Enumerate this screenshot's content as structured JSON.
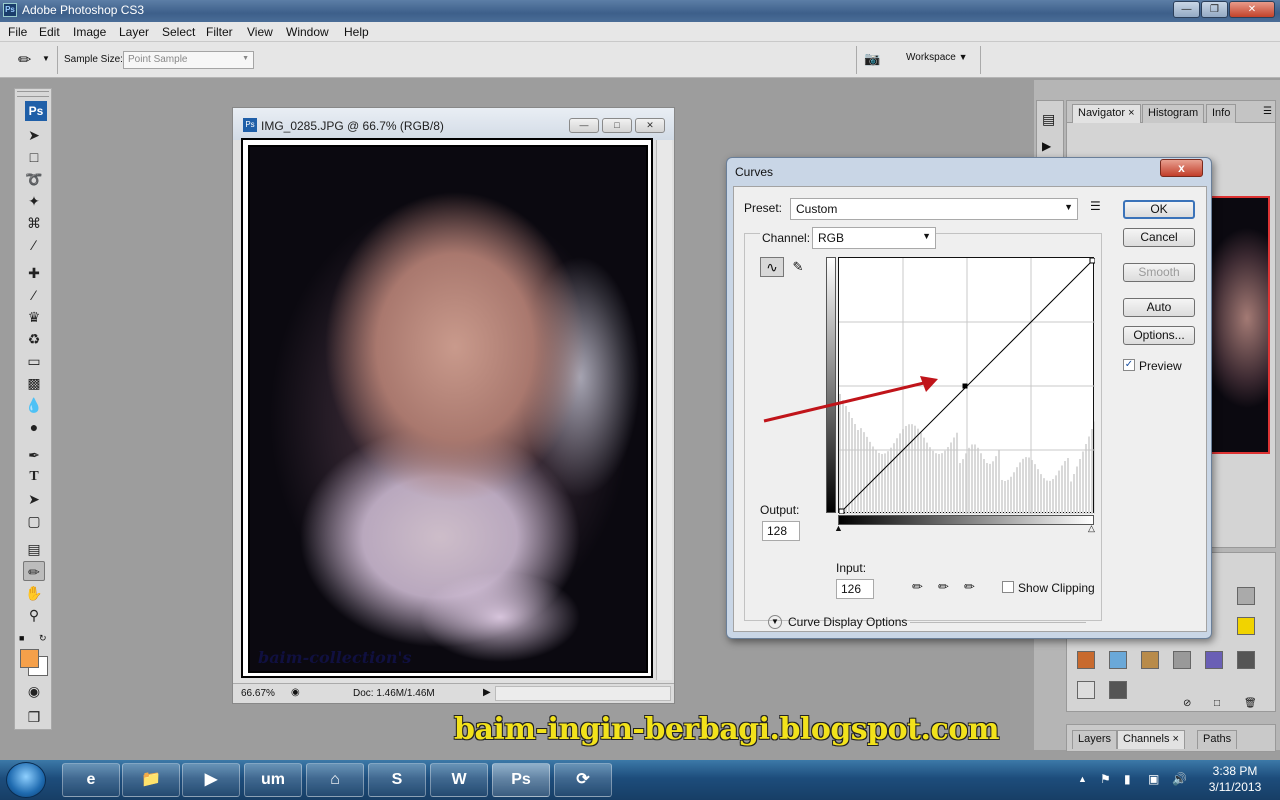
{
  "app": {
    "title": "Adobe Photoshop CS3",
    "logo": "Ps",
    "mini_logo": "Ps"
  },
  "menu": [
    "File",
    "Edit",
    "Image",
    "Layer",
    "Select",
    "Filter",
    "View",
    "Window",
    "Help"
  ],
  "options_bar": {
    "sample_size_label": "Sample Size:",
    "sample_size_value": "Point Sample",
    "workspace_label": "Workspace"
  },
  "document": {
    "title": "IMG_0285.JPG @ 66.7% (RGB/8)",
    "zoom": "66.67%",
    "doc_info": "Doc: 1.46M/1.46M",
    "photo_watermark": "baim-collection's"
  },
  "panels": {
    "navigator_tabs": [
      "Navigator",
      "Histogram",
      "Info"
    ],
    "layer_tabs": [
      "Layers",
      "Channels",
      "Paths"
    ]
  },
  "curves": {
    "title": "Curves",
    "close": "x",
    "preset_label": "Preset:",
    "preset_value": "Custom",
    "channel_label": "Channel:",
    "channel_value": "RGB",
    "output_label": "Output:",
    "output_value": "128",
    "input_label": "Input:",
    "input_value": "126",
    "show_clipping_label": "Show Clipping",
    "curve_display_label": "Curve Display Options",
    "buttons": {
      "ok": "OK",
      "cancel": "Cancel",
      "smooth": "Smooth",
      "auto": "Auto",
      "options": "Options..."
    },
    "preview_label": "Preview",
    "preview_checked": true,
    "point": {
      "input": 126,
      "output": 128
    }
  },
  "watermark_text": "baim-ingin-berbagi.blogspot.com",
  "taskbar": {
    "time": "3:38 PM",
    "date": "3/11/2013"
  },
  "colors": {
    "foreground_swatch": "#f5a04a",
    "background_swatch": "#ffffff",
    "arrow": "#c0141a",
    "accent": "#1f5fa8"
  }
}
